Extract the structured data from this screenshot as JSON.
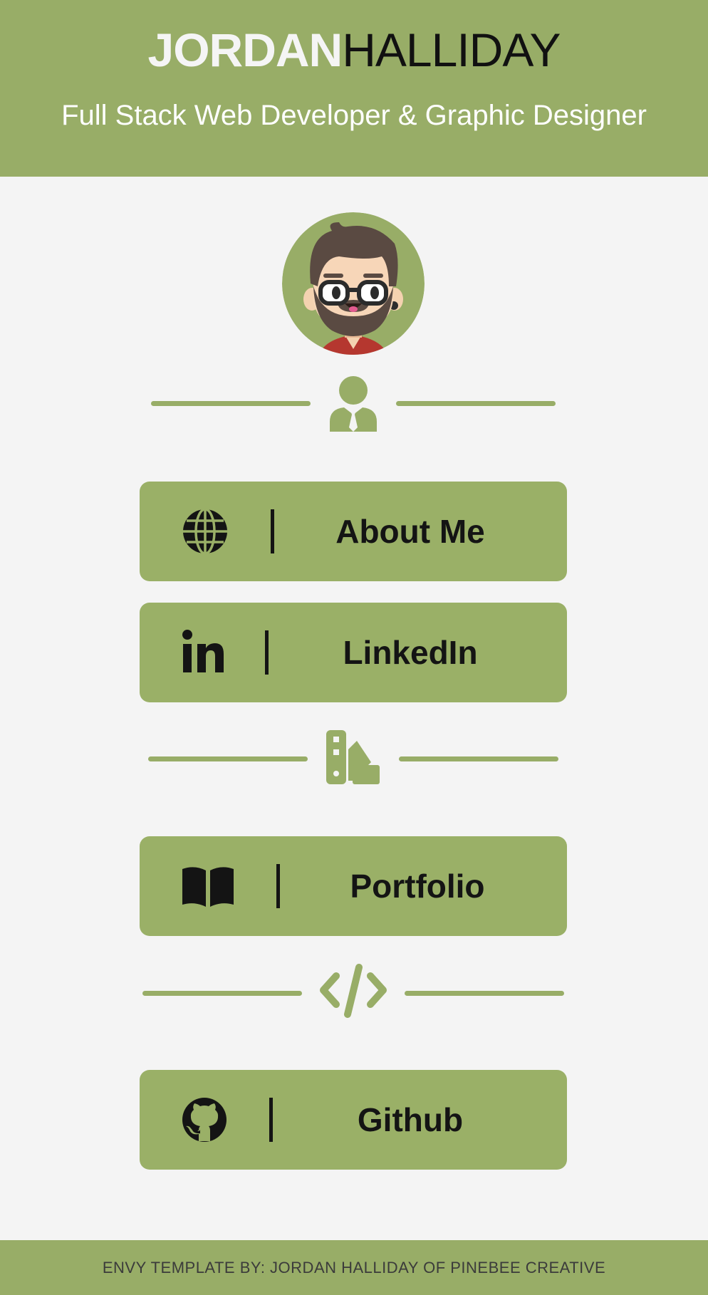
{
  "header": {
    "brand_first": "JORDAN",
    "brand_last": "HALLIDAY",
    "tagline": "Full Stack Web Developer & Graphic Designer"
  },
  "avatar": {
    "icon": "bearded-developer-avatar"
  },
  "dividers": [
    {
      "icon": "user-tie-icon"
    },
    {
      "icon": "swatchbook-icon"
    },
    {
      "icon": "code-icon"
    }
  ],
  "links": [
    {
      "icon": "globe-icon",
      "label": "About Me"
    },
    {
      "icon": "linkedin-icon",
      "label": "LinkedIn"
    },
    {
      "icon": "book-open-icon",
      "label": "Portfolio"
    },
    {
      "icon": "github-icon",
      "label": "Github"
    }
  ],
  "footer": {
    "text": "ENVY TEMPLATE BY: JORDAN HALLIDAY OF PINEBEE CREATIVE"
  },
  "colors": {
    "accent": "#98ad67",
    "background": "#f4f4f4",
    "text_dark": "#141414"
  }
}
